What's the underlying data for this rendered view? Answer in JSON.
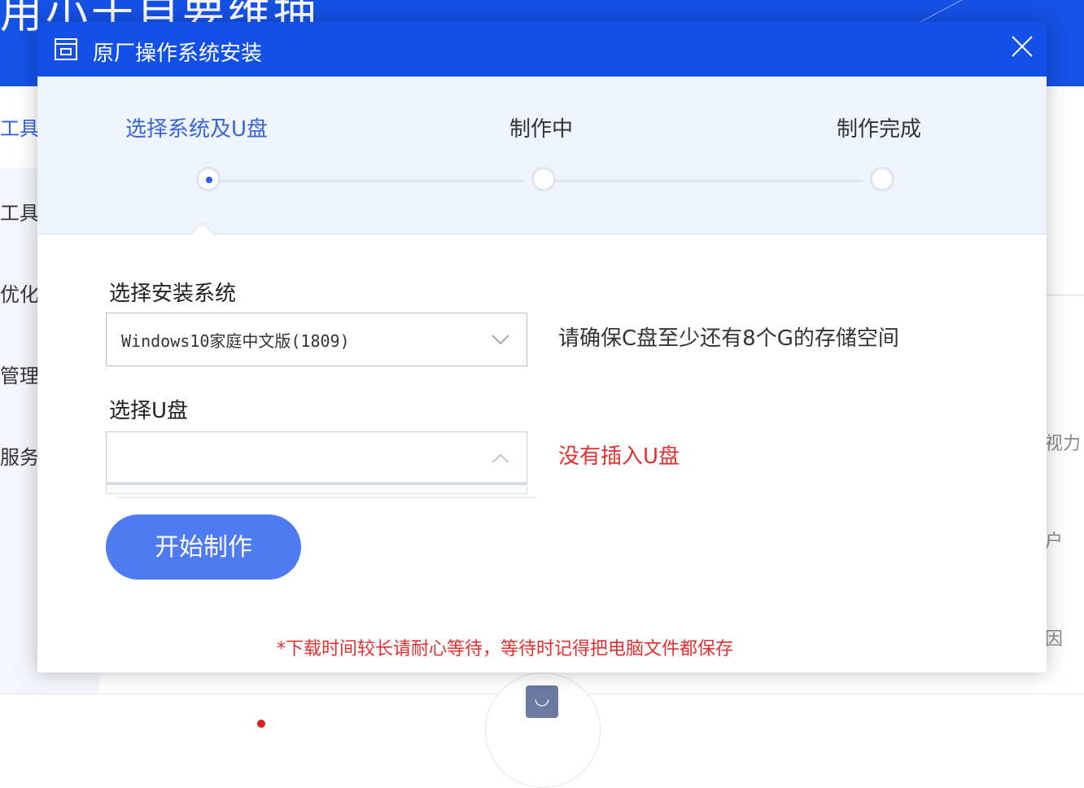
{
  "background": {
    "header_title": "用小于自要维抽",
    "sidebar_items": [
      "工具",
      "工具",
      "优化",
      "管理",
      "服务"
    ],
    "right_texts": [
      "视力",
      "户",
      "因"
    ]
  },
  "modal": {
    "title": "原厂操作系统安装",
    "close_icon": "close-icon",
    "steps": [
      {
        "label": "选择系统及U盘",
        "state": "active"
      },
      {
        "label": "制作中",
        "state": "pending"
      },
      {
        "label": "制作完成",
        "state": "pending"
      }
    ],
    "system_field": {
      "label": "选择安装系统",
      "value": "Windows10家庭中文版(1809)",
      "hint": "请确保C盘至少还有8个G的存储空间"
    },
    "usb_field": {
      "label": "选择U盘",
      "value": "",
      "hint": "没有插入U盘"
    },
    "start_button": "开始制作",
    "footnote": "*下载时间较长请耐心等待，等待时记得把电脑文件都保存"
  },
  "colors": {
    "titlebar": "#1250e8",
    "accent": "#4f7bf0",
    "warning": "#e03030",
    "steps_bg": "#eff3fc"
  }
}
